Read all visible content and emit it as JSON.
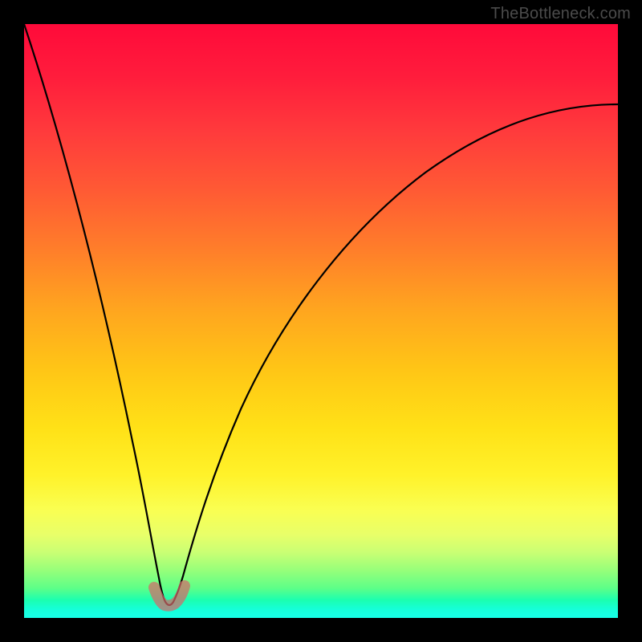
{
  "watermark": {
    "text": "TheBottleneck.com"
  },
  "colors": {
    "background": "#000000",
    "curve_stroke": "#000000",
    "highlight_stroke": "#d46a6a",
    "gradient_stops": [
      "#ff0a3a",
      "#ff1d3c",
      "#ff3a3c",
      "#ff5a34",
      "#ff7e2a",
      "#ffa51f",
      "#ffc516",
      "#ffe117",
      "#fff22a",
      "#f9ff53",
      "#e8ff69",
      "#c9ff74",
      "#96ff7a",
      "#5dff88",
      "#1bffb0",
      "#16ffd8",
      "#18ffe8"
    ]
  },
  "chart_data": {
    "type": "line",
    "title": "",
    "xlabel": "",
    "ylabel": "",
    "xlim": [
      0,
      1
    ],
    "ylim": [
      0,
      1
    ],
    "grid": false,
    "legend": false,
    "note": "V-shaped bottleneck curve; minimum marked by pink highlight near x≈0.24",
    "series": [
      {
        "name": "bottleneck-curve",
        "x": [
          0.0,
          0.03,
          0.06,
          0.09,
          0.12,
          0.15,
          0.18,
          0.2,
          0.22,
          0.235,
          0.245,
          0.255,
          0.27,
          0.29,
          0.32,
          0.36,
          0.41,
          0.48,
          0.56,
          0.66,
          0.78,
          0.9,
          1.0
        ],
        "y": [
          1.0,
          0.87,
          0.74,
          0.61,
          0.48,
          0.35,
          0.22,
          0.14,
          0.07,
          0.02,
          0.0,
          0.02,
          0.07,
          0.14,
          0.23,
          0.33,
          0.43,
          0.54,
          0.64,
          0.73,
          0.8,
          0.84,
          0.86
        ]
      }
    ],
    "highlight": {
      "x_range": [
        0.215,
        0.275
      ],
      "y": 0.0
    }
  }
}
